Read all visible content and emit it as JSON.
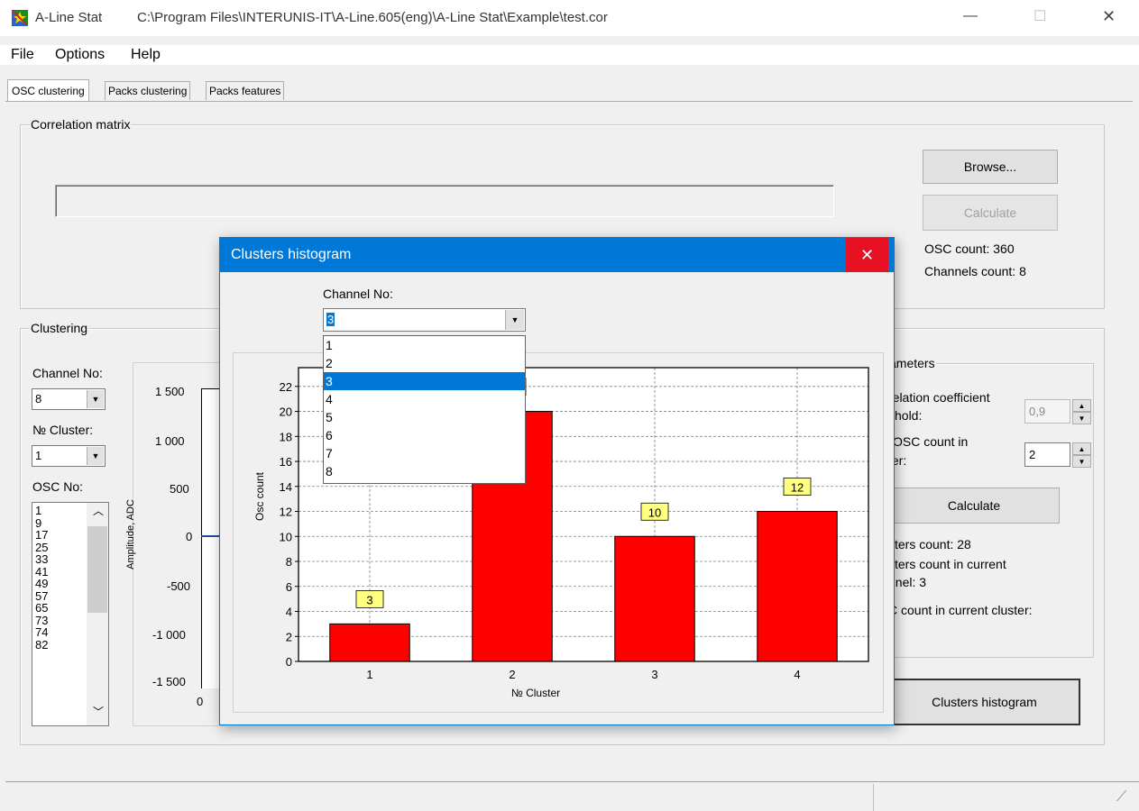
{
  "window": {
    "app_name": "A-Line Stat",
    "file_path": "C:\\Program Files\\INTERUNIS-IT\\A-Line.605(eng)\\A-Line Stat\\Example\\test.cor",
    "minimize_glyph": "—",
    "maximize_glyph": "☐",
    "close_glyph": "✕"
  },
  "menu": [
    "File",
    "Options",
    "Help"
  ],
  "tabs": [
    "OSC clustering",
    "Packs clustering",
    "Packs features"
  ],
  "correlation": {
    "label": "Correlation matrix",
    "browse": "Browse...",
    "calculate": "Calculate",
    "osc_count": "OSC count: 360",
    "channels_count": "Channels count: 8"
  },
  "clustering": {
    "label": "Clustering",
    "channel_label": "Channel No:",
    "channel_value": "8",
    "cluster_label": "№ Cluster:",
    "cluster_value": "1",
    "osc_label": "OSC No:",
    "osc_items": [
      "1",
      "9",
      "17",
      "25",
      "33",
      "41",
      "49",
      "57",
      "65",
      "73",
      "74",
      "82"
    ],
    "y_ticks": [
      "1 500",
      "1 000",
      "500",
      "0",
      "-500",
      "-1 000",
      "-1 500"
    ],
    "y_axis_label": "Amplitude, ADC",
    "x_tick": "0"
  },
  "parameters": {
    "label_partial": "ameters",
    "corr_line1": "relation coefficient",
    "corr_line2": "shold:",
    "corr_value": "0,9",
    "osc_line1": "OSC count in",
    "osc_line2": "ter:",
    "osc_value": "2",
    "calculate": "Calculate",
    "clusters_count": "sters count: 28",
    "clusters_in_channel_1": "sters count in current",
    "clusters_in_channel_2": "nnel: 3",
    "osc_in_cluster": "C count in current cluster:",
    "histogram_button": "Clusters histogram"
  },
  "dialog": {
    "title": "Clusters histogram",
    "channel_label": "Channel No:",
    "channel_value": "3",
    "options": [
      "1",
      "2",
      "3",
      "4",
      "5",
      "6",
      "7",
      "8"
    ],
    "selected_index": 2,
    "close_glyph": "✕"
  },
  "colors": {
    "title_bar": "#0078d7",
    "close_red": "#e81123",
    "bar": "#ff0000",
    "label_bg": "#ffff80",
    "select": "#0078d7"
  },
  "chart_data": {
    "type": "bar",
    "categories": [
      "1",
      "2",
      "3",
      "4"
    ],
    "values": [
      3,
      20,
      10,
      12
    ],
    "data_labels": [
      "3",
      "20",
      "10",
      "12"
    ],
    "xlabel": "№ Cluster",
    "ylabel": "Osc count",
    "ylim": [
      0,
      23.5
    ],
    "y_ticks": [
      0,
      2,
      4,
      6,
      8,
      10,
      12,
      14,
      16,
      18,
      20,
      22
    ],
    "grid": true
  }
}
